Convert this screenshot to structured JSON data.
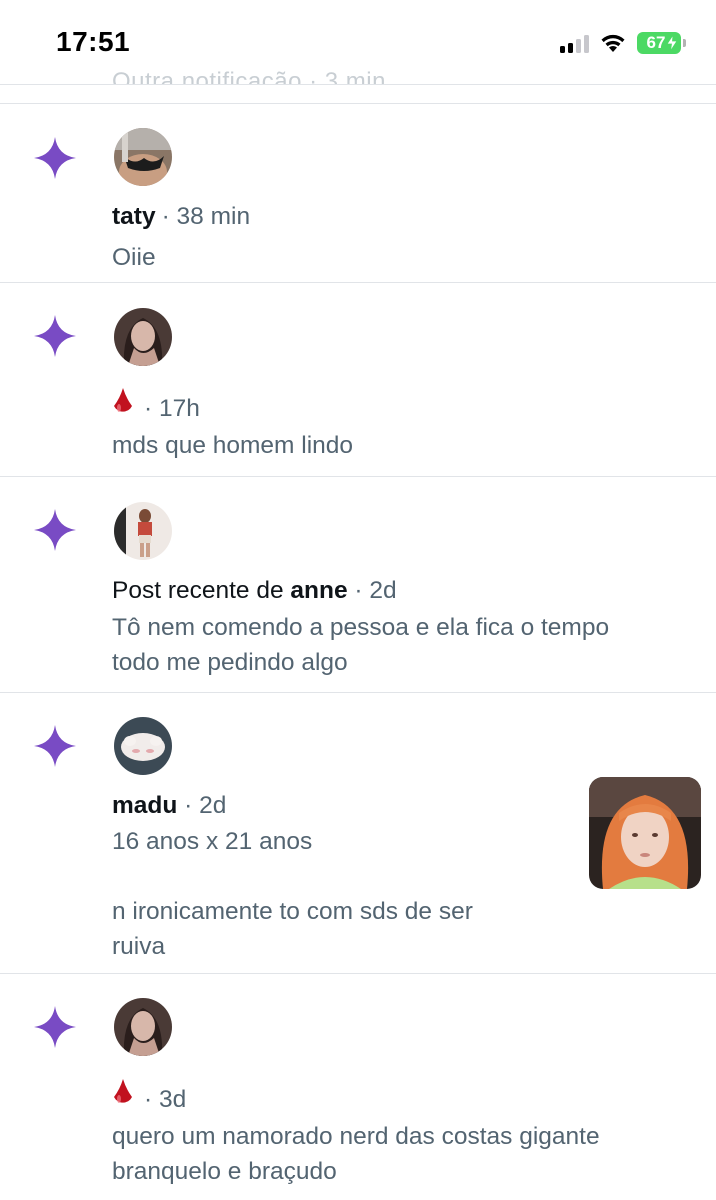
{
  "status_bar": {
    "time": "17:51",
    "battery_level": "67",
    "icons": [
      "cellular-signal-icon",
      "wifi-icon",
      "battery-charging-icon"
    ]
  },
  "clipped_previous_text": "Outra notificação · 3 min",
  "notifications": [
    {
      "icon": "sparkle-icon",
      "name": "taty",
      "prefix": "",
      "time": "· 38 min",
      "text": "Oiie"
    },
    {
      "icon": "sparkle-icon",
      "emoji": "drop-of-blood-emoji",
      "time": "· 17h",
      "text": "mds que homem lindo"
    },
    {
      "icon": "sparkle-icon",
      "prefix": "Post recente de ",
      "name": "anne",
      "time": " · 2d",
      "text": "Tô nem comendo a pessoa e ela fica o tempo\ntodo me pedindo algo"
    },
    {
      "icon": "sparkle-icon",
      "name": "madu",
      "time": " · 2d",
      "text": "16 anos x 21 anos\n\nn ironicamente to com sds de ser\nruiva",
      "has_media": true
    },
    {
      "icon": "sparkle-icon",
      "emoji": "drop-of-blood-emoji",
      "time": "· 3d",
      "text": "quero um namorado nerd das costas gigante\nbranquelo e braçudo"
    }
  ],
  "colors": {
    "sparkle": "#794bc4",
    "meta_text": "#536471",
    "primary_text": "#0f1419",
    "divider": "#e1e4e8",
    "battery": "#4cd964"
  }
}
